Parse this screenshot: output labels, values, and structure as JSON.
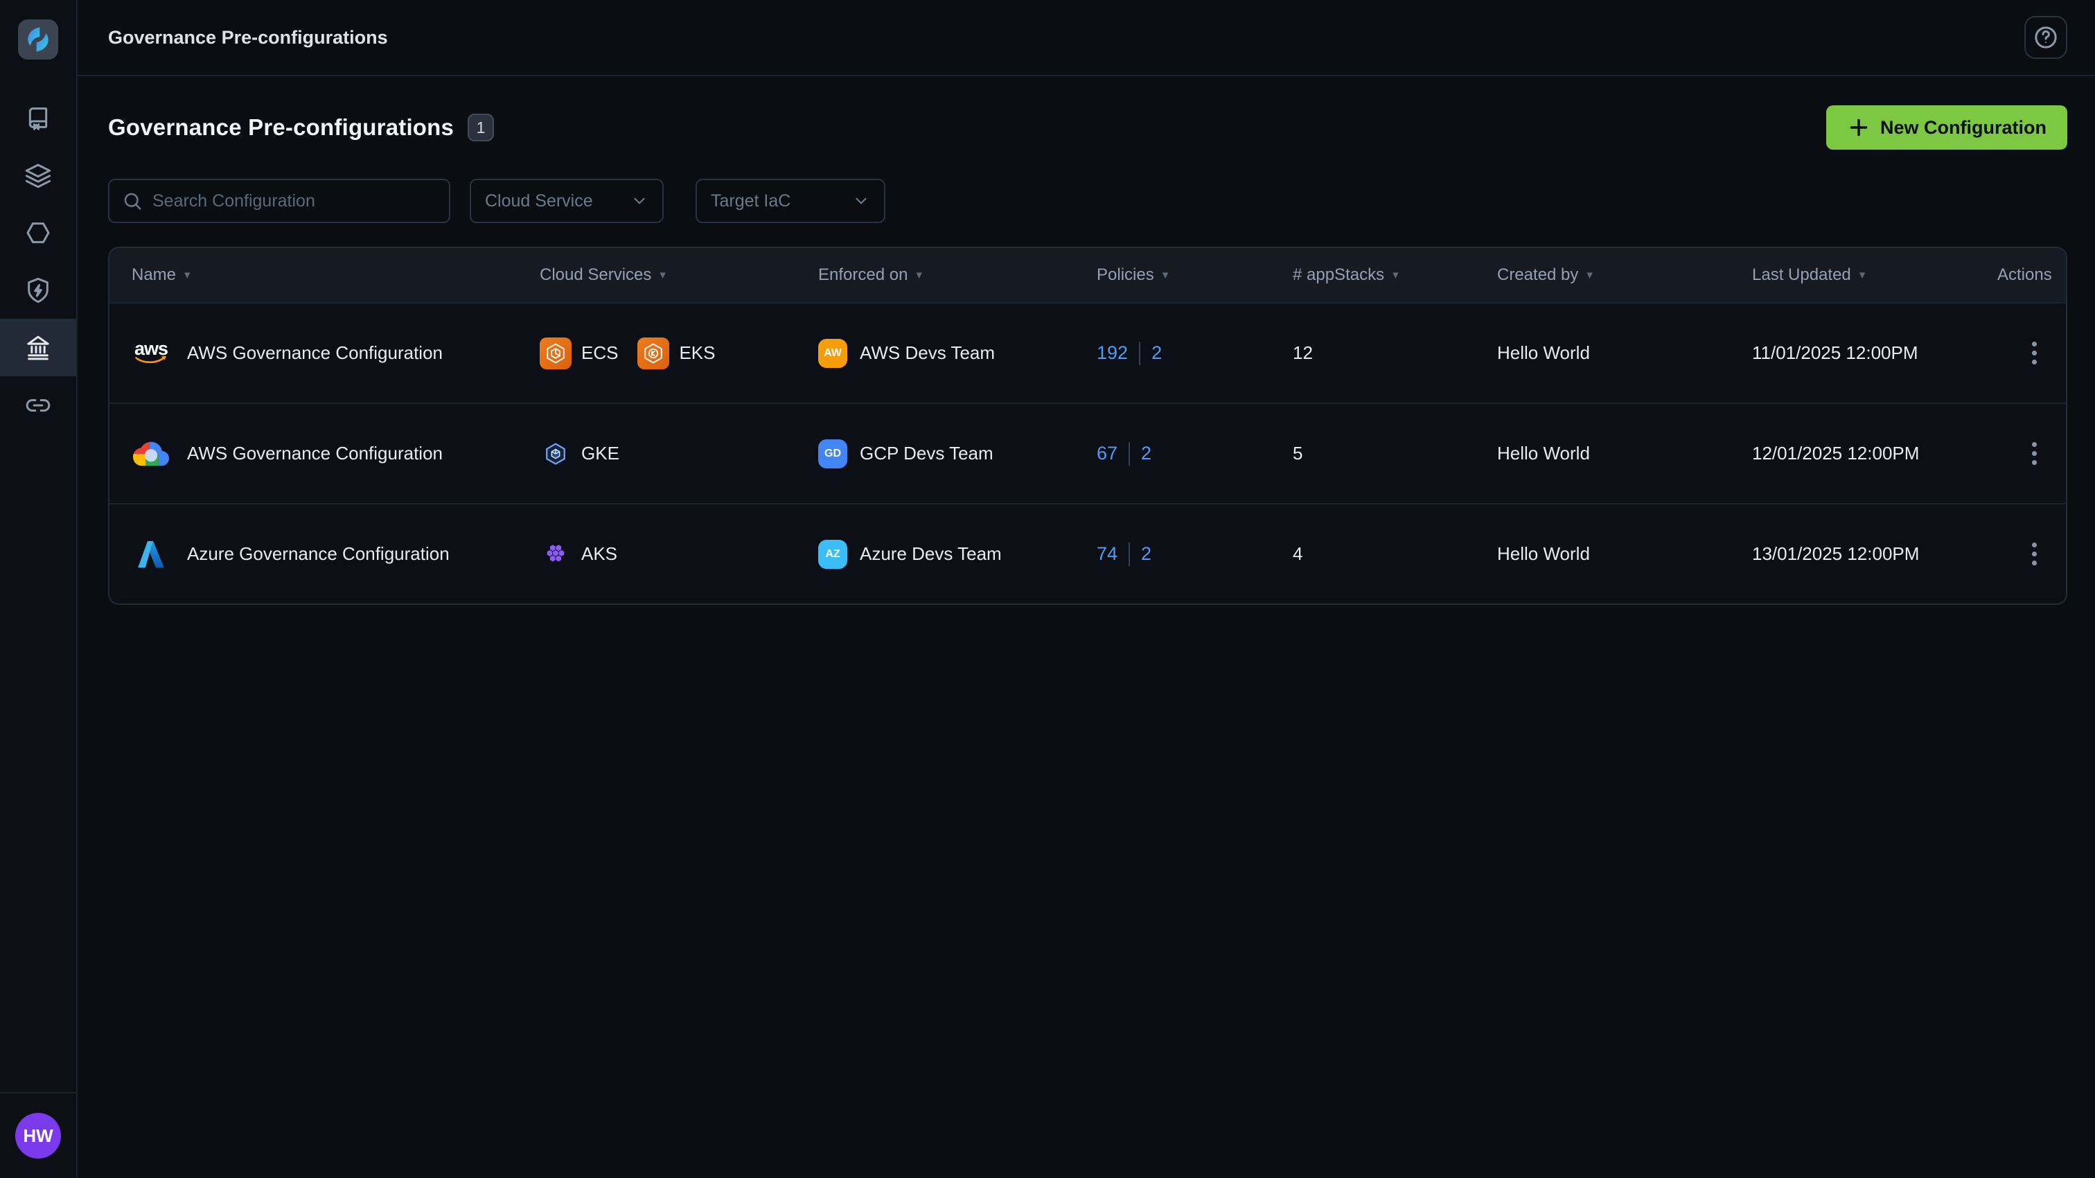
{
  "topbar": {
    "title": "Governance Pre-configurations"
  },
  "sidebar": {
    "icons": [
      "app-logo",
      "book-icon",
      "layers-icon",
      "hexagon-icon",
      "shield-bolt-icon",
      "bank-icon",
      "link-icon"
    ],
    "active_item": "governance",
    "avatar_initials": "HW"
  },
  "page": {
    "title": "Governance Pre-configurations",
    "count_badge": "1",
    "new_button_label": "New Configuration",
    "filters": {
      "search_placeholder": "Search Configuration",
      "cloud_service_label": "Cloud Service",
      "target_iac_label": "Target IaC"
    }
  },
  "table": {
    "columns": [
      "Name",
      "Cloud Services",
      "Enforced on",
      "Policies",
      "# appStacks",
      "Created by",
      "Last Updated",
      "Actions"
    ],
    "rows": [
      {
        "name": "AWS Governance Configuration",
        "provider": "aws",
        "services": [
          {
            "label": "ECS",
            "icon": "aws-ecs-icon"
          },
          {
            "label": "EKS",
            "icon": "aws-eks-icon"
          }
        ],
        "enforced": {
          "initials": "AW",
          "team": "AWS Devs Team",
          "color": "#f59e0b"
        },
        "policies": {
          "count": "192",
          "extra": "2"
        },
        "appstacks": "12",
        "created_by": "Hello World",
        "last_updated": "11/01/2025 12:00PM"
      },
      {
        "name": "AWS Governance Configuration",
        "provider": "gcp",
        "services": [
          {
            "label": "GKE",
            "icon": "gcp-gke-icon"
          }
        ],
        "enforced": {
          "initials": "GD",
          "team": "GCP Devs Team",
          "color": "#4285f4"
        },
        "policies": {
          "count": "67",
          "extra": "2"
        },
        "appstacks": "5",
        "created_by": "Hello World",
        "last_updated": "12/01/2025 12:00PM"
      },
      {
        "name": "Azure Governance Configuration",
        "provider": "azure",
        "services": [
          {
            "label": "AKS",
            "icon": "azure-aks-icon"
          }
        ],
        "enforced": {
          "initials": "AZ",
          "team": "Azure Devs Team",
          "color": "#3bbdf5"
        },
        "policies": {
          "count": "74",
          "extra": "2"
        },
        "appstacks": "4",
        "created_by": "Hello World",
        "last_updated": "13/01/2025 12:00PM"
      }
    ]
  },
  "colors": {
    "accent_green": "#7dc843",
    "link_blue": "#4d9df8",
    "avatar_purple": "#7c3aed",
    "aws_orange": "#e8731b",
    "aws_swoosh": "#ff9900",
    "amber_badge": "#f59e0b",
    "gcp_blue": "#4285f4",
    "azure_cyan": "#3bbdf5",
    "aks_purple": "#8b5cf6"
  }
}
